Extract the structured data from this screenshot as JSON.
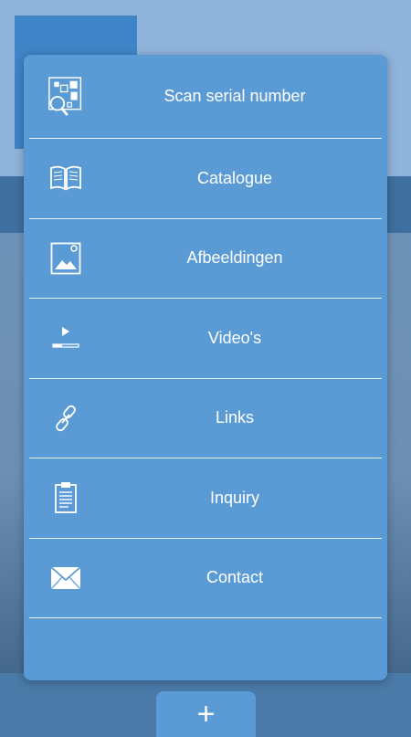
{
  "menu": {
    "items": [
      {
        "label": "Scan serial number",
        "icon": "scan-serial-icon"
      },
      {
        "label": "Catalogue",
        "icon": "book-icon"
      },
      {
        "label": "Afbeeldingen",
        "icon": "image-icon"
      },
      {
        "label": "Video's",
        "icon": "video-icon"
      },
      {
        "label": "Links",
        "icon": "link-icon"
      },
      {
        "label": "Inquiry",
        "icon": "clipboard-icon"
      },
      {
        "label": "Contact",
        "icon": "envelope-icon"
      }
    ]
  },
  "fab": {
    "label": "+"
  },
  "colors": {
    "panel": "#5b9bd5",
    "accent": "#3f84c6",
    "background": "#4a7aa8"
  }
}
